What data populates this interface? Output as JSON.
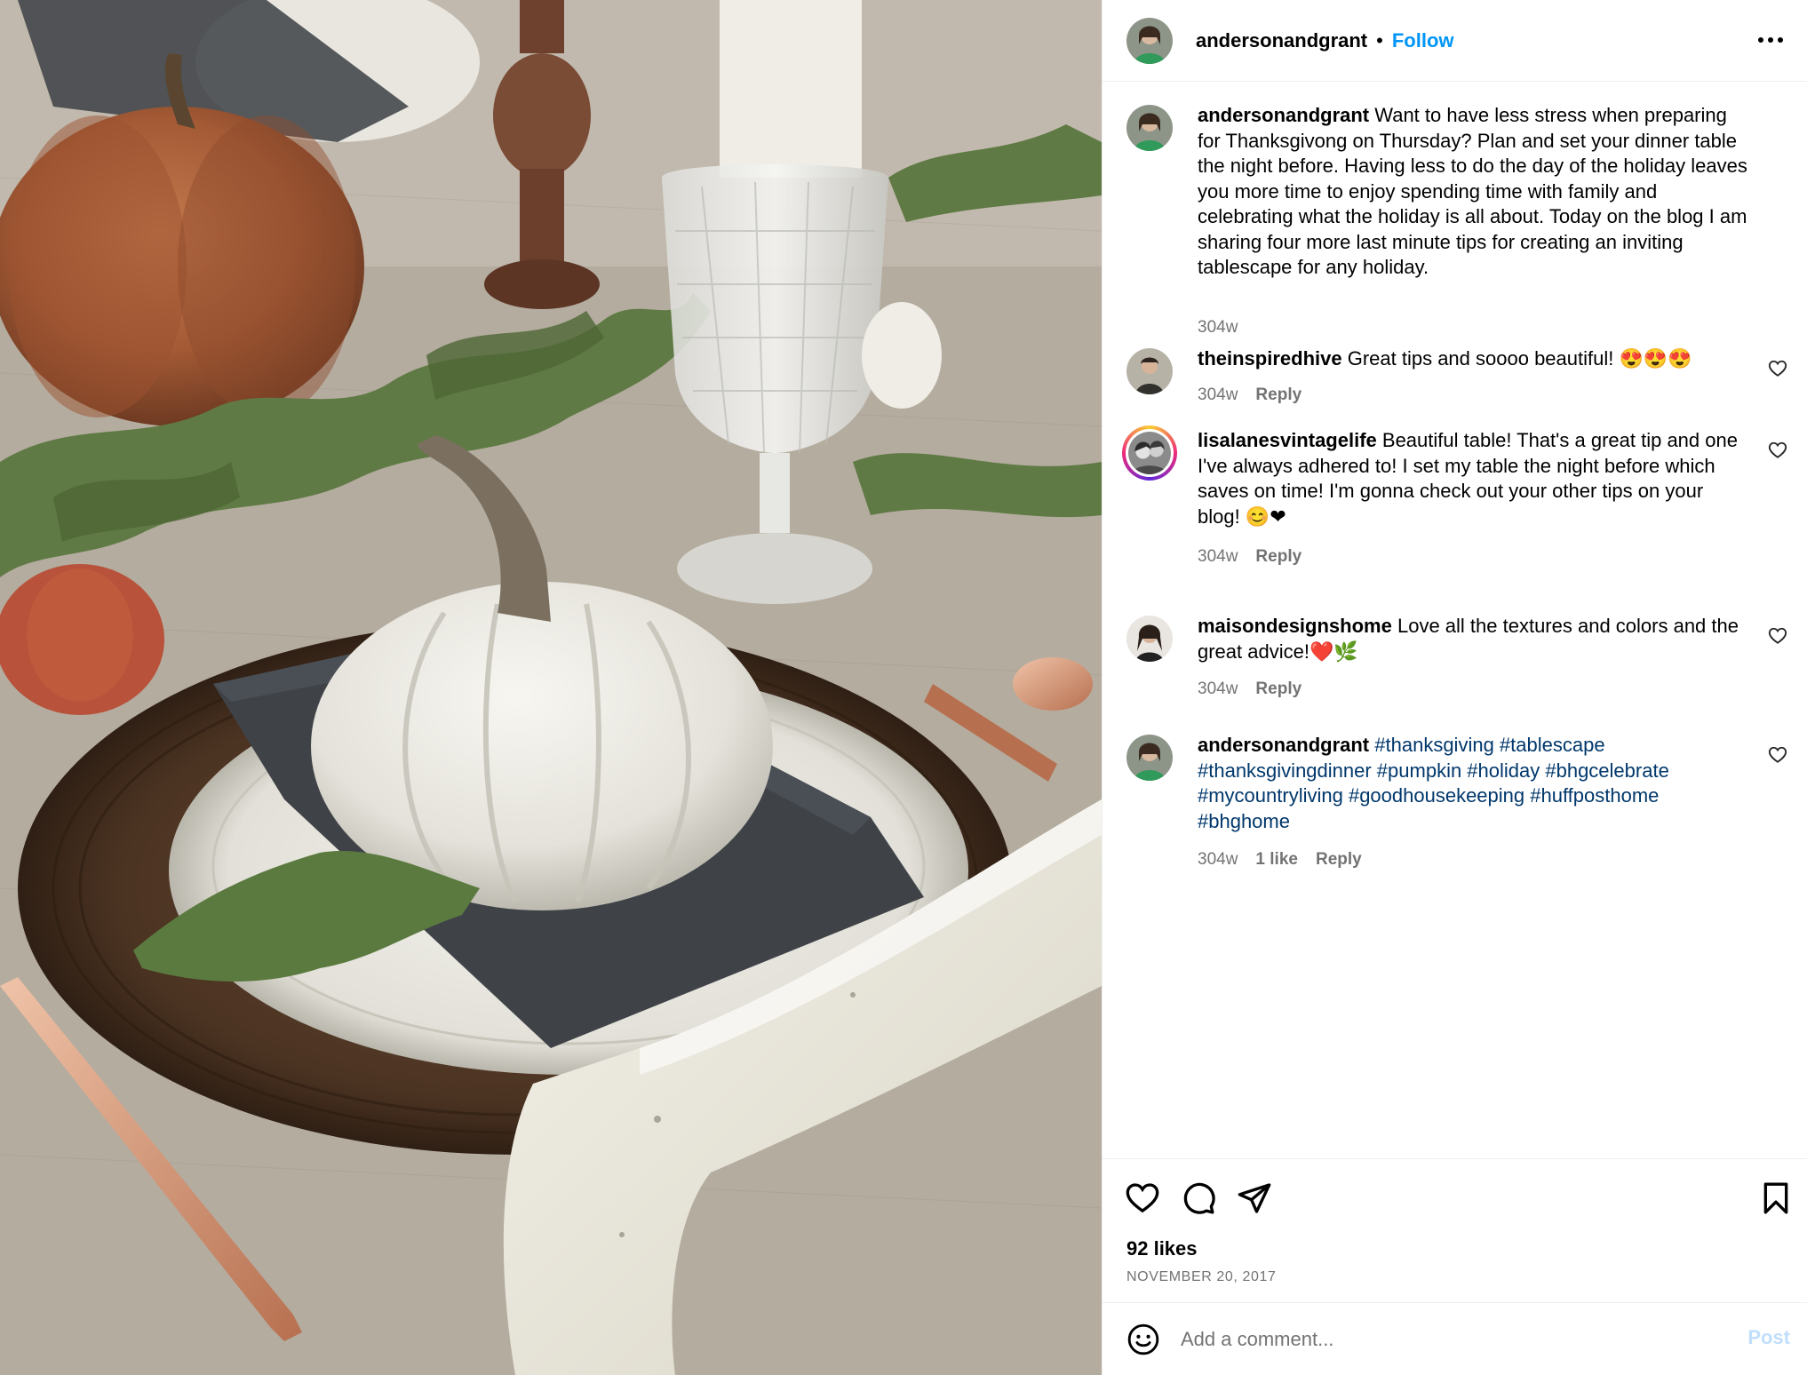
{
  "post": {
    "username": "andersonandgrant",
    "separator": "•",
    "follow_label": "Follow",
    "more_icon": "more-options-icon"
  },
  "caption": {
    "user": "andersonandgrant",
    "text": "Want to have less stress when preparing for Thanksgivong on Thursday? Plan and set your dinner table the night before. Having less to do the day of the holiday leaves you more time to enjoy spending time with family and celebrating what the holiday is all about. Today on the blog I am sharing four more last minute tips for creating an inviting tablescape for any holiday.",
    "time": "304w"
  },
  "comments": [
    {
      "user": "theinspiredhive",
      "text": "Great tips and soooo beautiful! 😍😍😍",
      "time": "304w",
      "reply_label": "Reply"
    },
    {
      "user": "lisalanesvintagelife",
      "text": "Beautiful table! That's a great tip and one I've always adhered to! I set my table the night before which saves on time! I'm gonna check out your other tips on your blog! 😊❤",
      "time": "304w",
      "reply_label": "Reply"
    },
    {
      "user": "maisondesignshome",
      "text": "Love all the textures and colors and the great advice!❤️🌿",
      "time": "304w",
      "reply_label": "Reply"
    },
    {
      "user": "andersonandgrant",
      "tags": "#thanksgiving #tablescape #thanksgivingdinner #pumpkin #holiday #bhgcelebrate #mycountryliving #goodhousekeeping #huffposthome #bhghome",
      "time": "304w",
      "likes_label": "1 like",
      "reply_label": "Reply"
    }
  ],
  "actions": {
    "like_icon": "heart-icon",
    "comment_icon": "comment-icon",
    "share_icon": "share-icon",
    "save_icon": "bookmark-icon"
  },
  "likes": "92 likes",
  "date": "NOVEMBER 20, 2017",
  "add_comment": {
    "placeholder": "Add a comment...",
    "post_label": "Post",
    "emoji_icon": "emoji-icon"
  },
  "colors": {
    "link": "#0095f6",
    "hashtag": "#00376b",
    "muted": "#737373",
    "post_disabled": "#c0dffd"
  }
}
